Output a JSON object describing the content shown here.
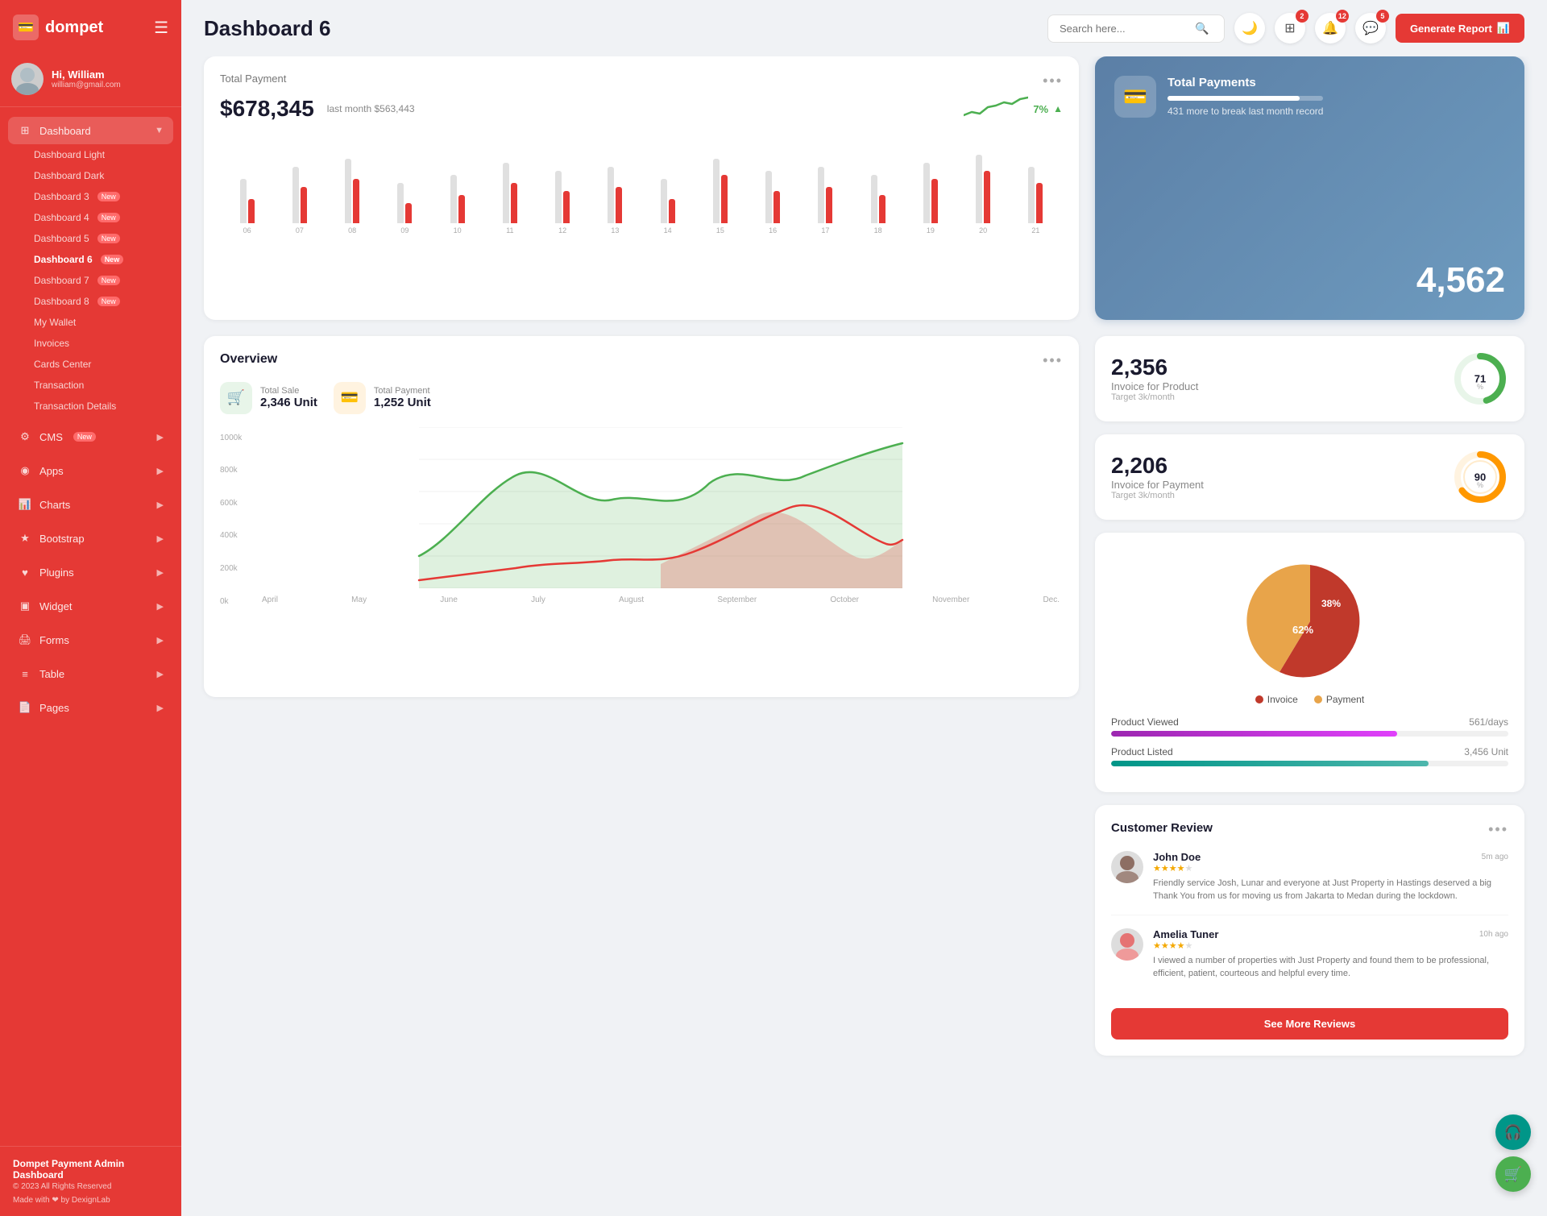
{
  "app": {
    "name": "dompet",
    "logo_icon": "💳"
  },
  "user": {
    "greeting": "Hi, William",
    "name": "William",
    "email": "william@gmail.com"
  },
  "header": {
    "page_title": "Dashboard 6",
    "search_placeholder": "Search here...",
    "generate_btn": "Generate Report",
    "notifications": {
      "apps_count": "2",
      "bell_count": "12",
      "chat_count": "5"
    }
  },
  "sidebar": {
    "menu_items": [
      {
        "id": "dashboard",
        "label": "Dashboard",
        "icon": "⊞",
        "has_arrow": true,
        "active": true
      },
      {
        "id": "cms",
        "label": "CMS",
        "icon": "⚙",
        "has_arrow": true,
        "badge": "New"
      },
      {
        "id": "apps",
        "label": "Apps",
        "icon": "◉",
        "has_arrow": true
      },
      {
        "id": "charts",
        "label": "Charts",
        "icon": "📊",
        "has_arrow": true
      },
      {
        "id": "bootstrap",
        "label": "Bootstrap",
        "icon": "★",
        "has_arrow": true
      },
      {
        "id": "plugins",
        "label": "Plugins",
        "icon": "♥",
        "has_arrow": true
      },
      {
        "id": "widget",
        "label": "Widget",
        "icon": "▣",
        "has_arrow": true
      },
      {
        "id": "forms",
        "label": "Forms",
        "icon": "🖨",
        "has_arrow": true
      },
      {
        "id": "table",
        "label": "Table",
        "icon": "≡",
        "has_arrow": true
      },
      {
        "id": "pages",
        "label": "Pages",
        "icon": "📄",
        "has_arrow": true
      }
    ],
    "sub_items": [
      {
        "id": "dashboard-light",
        "label": "Dashboard Light",
        "active": false
      },
      {
        "id": "dashboard-dark",
        "label": "Dashboard Dark",
        "active": false
      },
      {
        "id": "dashboard-3",
        "label": "Dashboard 3",
        "badge": "New",
        "active": false
      },
      {
        "id": "dashboard-4",
        "label": "Dashboard 4",
        "badge": "New",
        "active": false
      },
      {
        "id": "dashboard-5",
        "label": "Dashboard 5",
        "badge": "New",
        "active": false
      },
      {
        "id": "dashboard-6",
        "label": "Dashboard 6",
        "badge": "New",
        "active": true
      },
      {
        "id": "dashboard-7",
        "label": "Dashboard 7",
        "badge": "New",
        "active": false
      },
      {
        "id": "dashboard-8",
        "label": "Dashboard 8",
        "badge": "New",
        "active": false
      },
      {
        "id": "my-wallet",
        "label": "My Wallet",
        "active": false
      },
      {
        "id": "invoices",
        "label": "Invoices",
        "active": false
      },
      {
        "id": "cards-center",
        "label": "Cards Center",
        "active": false
      },
      {
        "id": "transaction",
        "label": "Transaction",
        "active": false
      },
      {
        "id": "transaction-details",
        "label": "Transaction Details",
        "active": false
      }
    ],
    "footer": {
      "app_name": "Dompet Payment Admin Dashboard",
      "copyright": "© 2023 All Rights Reserved",
      "made_with": "Made with ❤ by DexignLab"
    }
  },
  "total_payment": {
    "label": "Total Payment",
    "amount": "$678,345",
    "last_month": "last month $563,443",
    "trend_pct": "7%",
    "bars": [
      {
        "gray": 55,
        "red": 30,
        "label": "06"
      },
      {
        "gray": 70,
        "red": 45,
        "label": "07"
      },
      {
        "gray": 80,
        "red": 55,
        "label": "08"
      },
      {
        "gray": 50,
        "red": 25,
        "label": "09"
      },
      {
        "gray": 60,
        "red": 35,
        "label": "10"
      },
      {
        "gray": 75,
        "red": 50,
        "label": "11"
      },
      {
        "gray": 65,
        "red": 40,
        "label": "12"
      },
      {
        "gray": 70,
        "red": 45,
        "label": "13"
      },
      {
        "gray": 55,
        "red": 30,
        "label": "14"
      },
      {
        "gray": 80,
        "red": 60,
        "label": "15"
      },
      {
        "gray": 65,
        "red": 40,
        "label": "16"
      },
      {
        "gray": 70,
        "red": 45,
        "label": "17"
      },
      {
        "gray": 60,
        "red": 35,
        "label": "18"
      },
      {
        "gray": 75,
        "red": 55,
        "label": "19"
      },
      {
        "gray": 85,
        "red": 65,
        "label": "20"
      },
      {
        "gray": 70,
        "red": 50,
        "label": "21"
      }
    ]
  },
  "total_payments_card": {
    "label": "Total Payments",
    "number": "4,562",
    "sub": "431 more to break last month record",
    "progress_pct": 85
  },
  "invoice_product": {
    "number": "2,356",
    "label": "Invoice for Product",
    "target": "Target 3k/month",
    "pct": 71,
    "color": "#4caf50"
  },
  "invoice_payment": {
    "number": "2,206",
    "label": "Invoice for Payment",
    "target": "Target 3k/month",
    "pct": 90,
    "color": "#ff9800"
  },
  "overview": {
    "title": "Overview",
    "total_sale": {
      "label": "Total Sale",
      "value": "2,346 Unit"
    },
    "total_payment": {
      "label": "Total Payment",
      "value": "1,252 Unit"
    },
    "y_labels": [
      "0k",
      "200k",
      "400k",
      "600k",
      "800k",
      "1000k"
    ],
    "x_labels": [
      "April",
      "May",
      "June",
      "July",
      "August",
      "September",
      "October",
      "November",
      "Dec."
    ]
  },
  "pie_chart": {
    "invoice_pct": 62,
    "payment_pct": 38,
    "invoice_color": "#c0392b",
    "payment_color": "#e8a44a",
    "legend": [
      {
        "label": "Invoice",
        "color": "#c0392b"
      },
      {
        "label": "Payment",
        "color": "#e8a44a"
      }
    ]
  },
  "product_stats": [
    {
      "label": "Product Viewed",
      "value": "561/days",
      "pct": 72,
      "color": "purple"
    },
    {
      "label": "Product Listed",
      "value": "3,456 Unit",
      "pct": 80,
      "color": "teal"
    }
  ],
  "customer_review": {
    "title": "Customer Review",
    "reviews": [
      {
        "name": "John Doe",
        "rating": 4,
        "time": "5m ago",
        "text": "Friendly service Josh, Lunar and everyone at Just Property in Hastings deserved a big Thank You from us for moving us from Jakarta to Medan during the lockdown."
      },
      {
        "name": "Amelia Tuner",
        "rating": 4,
        "time": "10h ago",
        "text": "I viewed a number of properties with Just Property and found them to be professional, efficient, patient, courteous and helpful every time."
      }
    ],
    "see_more_btn": "See More Reviews"
  }
}
